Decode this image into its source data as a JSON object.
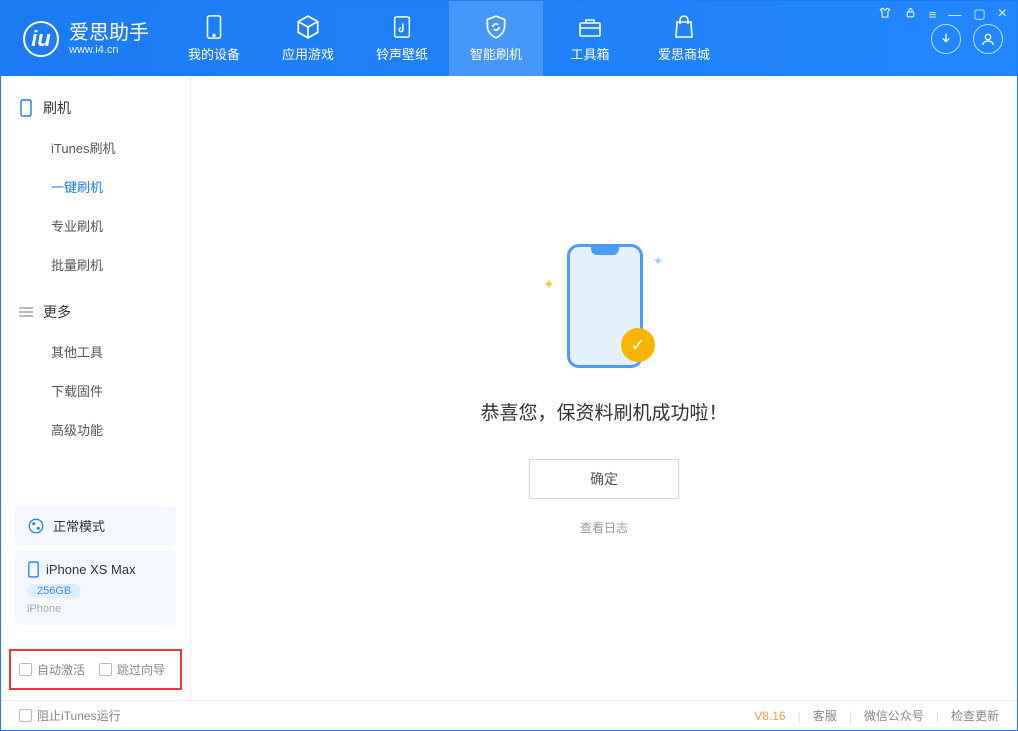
{
  "app": {
    "name_cn": "爱思助手",
    "name_en": "www.i4.cn"
  },
  "tabs": [
    {
      "label": "我的设备",
      "icon": "device-icon"
    },
    {
      "label": "应用游戏",
      "icon": "cube-icon"
    },
    {
      "label": "铃声壁纸",
      "icon": "music-file-icon"
    },
    {
      "label": "智能刷机",
      "icon": "shield-refresh-icon",
      "selected": true
    },
    {
      "label": "工具箱",
      "icon": "toolbox-icon"
    },
    {
      "label": "爱思商城",
      "icon": "bag-icon"
    }
  ],
  "sidebar": {
    "group1": {
      "title": "刷机",
      "items": [
        "iTunes刷机",
        "一键刷机",
        "专业刷机",
        "批量刷机"
      ],
      "active_index": 1
    },
    "group2": {
      "title": "更多",
      "items": [
        "其他工具",
        "下载固件",
        "高级功能"
      ]
    },
    "mode_label": "正常模式",
    "device": {
      "name": "iPhone XS Max",
      "storage": "256GB",
      "type": "iPhone"
    },
    "checkboxes": {
      "auto_activate": "自动激活",
      "skip_guide": "跳过向导"
    }
  },
  "main": {
    "success_message": "恭喜您，保资料刷机成功啦！",
    "ok_button": "确定",
    "log_link": "查看日志"
  },
  "status": {
    "block_itunes": "阻止iTunes运行",
    "version": "V8.16",
    "links": [
      "客服",
      "微信公众号",
      "检查更新"
    ]
  }
}
